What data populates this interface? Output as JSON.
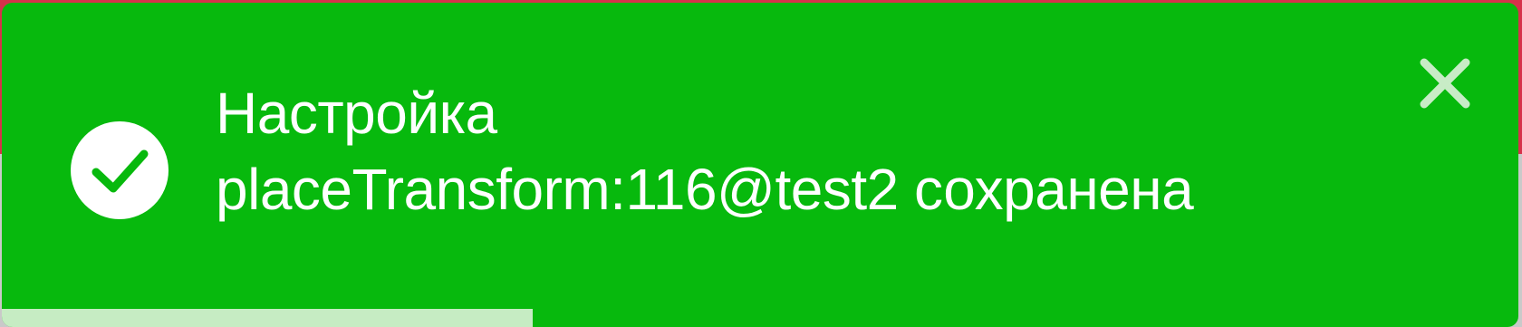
{
  "toast": {
    "type": "success",
    "icon": "checkmark-circle-icon",
    "message_line1": "Настройка",
    "message_line2": "placeTransform:116@test2 сохранена",
    "close_icon": "close-icon",
    "progress_fraction": 0.35,
    "colors": {
      "background": "#07b90d",
      "text": "#ffffff",
      "progress": "#c6ecc3",
      "page_top": "#d6324a"
    }
  }
}
